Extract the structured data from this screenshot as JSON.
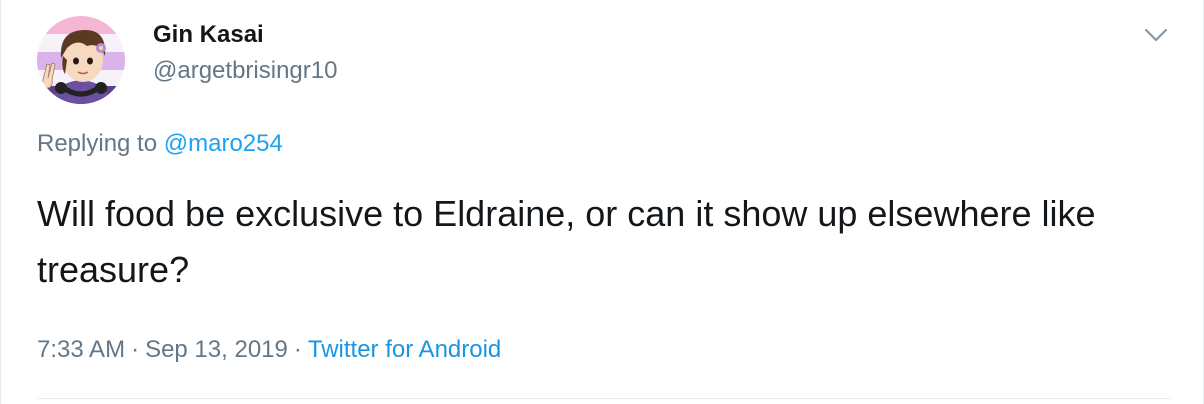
{
  "tweet": {
    "author": {
      "display_name": "Gin Kasai",
      "handle": "@argetbrisingr10"
    },
    "reply_context": {
      "prefix": "Replying to",
      "mention": "@maro254"
    },
    "text": "Will food be exclusive to Eldraine, or can it show up elsewhere like treasure?",
    "meta": {
      "time": "7:33 AM",
      "separator": "·",
      "date": "Sep 13, 2019",
      "source": "Twitter for Android"
    }
  },
  "icons": {
    "caret": "chevron-down-icon",
    "avatar": "cartoon-avatar"
  },
  "colors": {
    "link": "#1da1f2",
    "secondary_text": "#657786",
    "primary_text": "#14171a",
    "avatar_stripe_pink": "#f4b6d4",
    "avatar_stripe_purple": "#9b59b6"
  }
}
